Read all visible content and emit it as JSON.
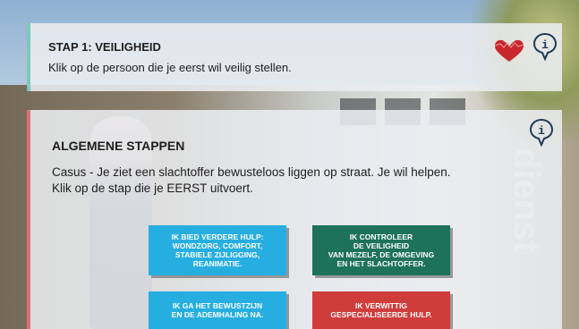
{
  "step_panel": {
    "title": "STAP 1: VEILIGHEID",
    "instruction": "Klik op de persoon die je eerst wil veilig stellen."
  },
  "main_panel": {
    "title": "ALGEMENE STAPPEN",
    "case_text": "Casus - Je ziet een slachtoffer bewusteloos liggen op straat. Je wil helpen.",
    "prompt_text": "Klik op de stap die je EERST uitvoert."
  },
  "options": [
    {
      "label": "IK BIED VERDERE HULP:\nWONDZORG, COMFORT,\nSTABIELE ZIJLIGGING,\nREANIMATIE.",
      "color": "#27aee0"
    },
    {
      "label": "IK CONTROLEER\nDE VEILIGHEID\nVAN MEZELF, DE OMGEVING\nEN HET SLACHTOFFER.",
      "color": "#1d7259"
    },
    {
      "label": "IK GA HET BEWUSTZIJN\nEN DE ADEMHALING NA.",
      "color": "#27aee0"
    },
    {
      "label": "IK VERWITTIG\nGESPECIALISEERDE HULP.",
      "color": "#cf3d3b"
    }
  ],
  "background_text": "dienst",
  "icons": {
    "lives": "heart-icon",
    "info": "info-icon"
  },
  "colors": {
    "heart": "#c8272e",
    "info_stroke": "#1e3a5a",
    "accent_top": "#7fc8b8",
    "accent_main": "#e07070"
  }
}
